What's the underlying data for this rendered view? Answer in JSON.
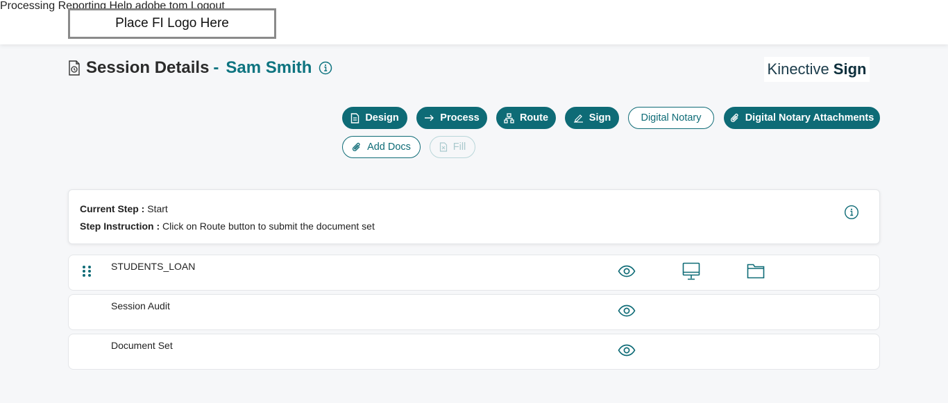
{
  "header": {
    "logo_text": "Place FI Logo Here",
    "nav": {
      "processing": "Processing",
      "reporting": "Reporting",
      "help": "Help",
      "user": "adobe tom",
      "logout": "Logout"
    }
  },
  "page": {
    "title": "Session Details",
    "separator": "-",
    "customer_name": "Sam Smith",
    "brand_light": "Kinective",
    "brand_bold": "Sign"
  },
  "actions": {
    "design": "Design",
    "process": "Process",
    "route": "Route",
    "sign": "Sign",
    "digital_notary": "Digital Notary",
    "digital_notary_attachments": "Digital Notary Attachments",
    "add_docs": "Add Docs",
    "fill": "Fill"
  },
  "step": {
    "current_label": "Current Step :",
    "current_value": "Start",
    "instruction_label": "Step Instruction :",
    "instruction_value": "Click on Route button to submit the document set"
  },
  "documents": [
    {
      "name": "STUDENTS_LOAN",
      "icons": [
        "eye-icon",
        "monitor-icon",
        "folder-icon"
      ]
    },
    {
      "name": "Session Audit",
      "icons": [
        "eye-icon"
      ]
    },
    {
      "name": "Document Set",
      "icons": [
        "eye-icon"
      ]
    }
  ],
  "colors": {
    "accent": "#0e6b76",
    "title_accent": "#0e7480",
    "background": "#f6f7f9"
  }
}
